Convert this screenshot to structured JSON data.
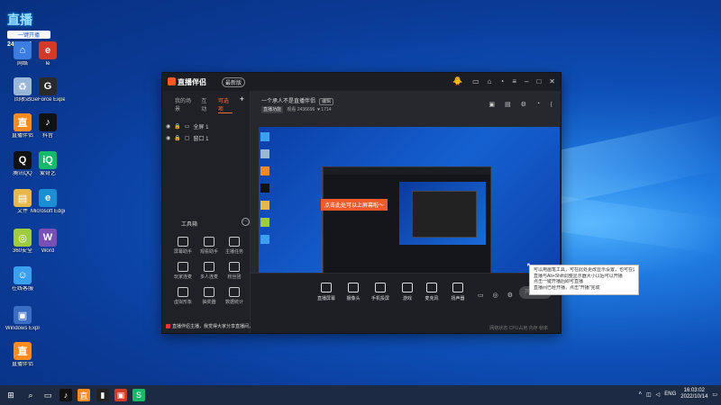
{
  "desktop": {
    "icons": [
      {
        "label": "网络",
        "color": "#3b7de0",
        "glyph": "⌂"
      },
      {
        "label": "Ie",
        "color": "#d23a2a",
        "glyph": "e"
      },
      {
        "label": "回收站",
        "color": "#9ab7d8",
        "glyph": "♻"
      },
      {
        "label": "GeForce Experience",
        "color": "#2a2a2a",
        "glyph": "G"
      },
      {
        "label": "直播伴侣",
        "color": "#ff8a1e",
        "glyph": "直"
      },
      {
        "label": "抖音",
        "color": "#111",
        "glyph": "♪"
      },
      {
        "label": "腾讯QQ",
        "color": "#111",
        "glyph": "Q"
      },
      {
        "label": "爱奇艺",
        "color": "#16b86a",
        "glyph": "iQ"
      },
      {
        "label": "文件",
        "color": "#e8b84a",
        "glyph": "▤"
      },
      {
        "label": "Microsoft Edge",
        "color": "#1a8fd4",
        "glyph": "e"
      },
      {
        "label": "360安全",
        "color": "#9fcb3c",
        "glyph": "◎"
      },
      {
        "label": "Word",
        "color": "#7a4fb6",
        "glyph": "W"
      },
      {
        "label": "在线客服",
        "color": "#3ba0f0",
        "glyph": "☺"
      },
      {
        "label": "Windows Explorer",
        "color": "#3a6ec4",
        "glyph": "▣"
      },
      {
        "label": "直播伴侣",
        "color": "#ff8a1e",
        "glyph": "直"
      }
    ],
    "banner": {
      "line1": "一键开播",
      "line2": "2436696"
    }
  },
  "app": {
    "title": "直播伴侣",
    "version": "最新版",
    "sidebar_tabs": [
      "我的场景",
      "互动",
      "玩法"
    ],
    "active_tab": "可选项",
    "scenes": [
      {
        "label": "全屏 1"
      },
      {
        "label": "窗口 1"
      }
    ],
    "tools_title": "工具箱",
    "tools": [
      {
        "label": "屏幕助手"
      },
      {
        "label": "观看助手"
      },
      {
        "label": "主播任务"
      },
      {
        "label": "玩家连麦"
      },
      {
        "label": "多人连麦"
      },
      {
        "label": "粉丝团"
      },
      {
        "label": "虚拟形象"
      },
      {
        "label": "抽奖器"
      },
      {
        "label": "数据统计"
      }
    ],
    "notice": "直播伴侣主播，我觉得大家分享直播间，请立即取消直播",
    "stream_title": "一个承人不是直播伴侣",
    "edit_label": "编辑",
    "category": "直播功能",
    "views": "2436696",
    "likes": "1714",
    "orange_tip": "点击此处可以上屏幕啦～",
    "controls": [
      {
        "label": "直播屏幕"
      },
      {
        "label": "摄像头"
      },
      {
        "label": "手机投屏"
      },
      {
        "label": "游戏"
      },
      {
        "label": "麦克风"
      },
      {
        "label": "扬声器"
      }
    ],
    "golive": "开始直播",
    "status": "网络状态 CPU占用 内存 帧率"
  },
  "tooltip": [
    "可以用画笔工具，可在此处更改显示设置，也可在这里开始",
    "直播与Alt+Shift调整显示器大小以后可以开播",
    "点击一键开播后即可直播",
    "直播间已经开播，点击\"开播\"完成"
  ],
  "taskbar": {
    "time": "16:03:02",
    "date": "2022/10/14",
    "lang": "ENG"
  }
}
